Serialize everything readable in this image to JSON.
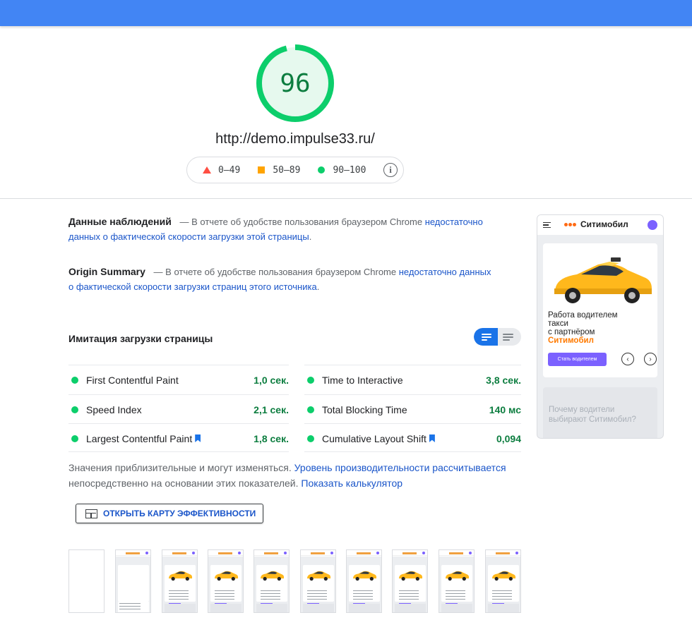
{
  "score": {
    "value": "96",
    "fraction": 0.96,
    "color": "#0cce6b"
  },
  "url": "http://demo.impulse33.ru/",
  "legend": {
    "low": "0–49",
    "mid": "50–89",
    "high": "90–100",
    "info_glyph": "i"
  },
  "field_data": {
    "title": "Данные наблюдений",
    "dash": "—",
    "text": "В отчете об удобстве пользования браузером Chrome",
    "link": "недостаточно данных о фактической скорости загрузки этой страницы",
    "end": "."
  },
  "origin_summary": {
    "title": "Origin Summary",
    "dash": "—",
    "text": "В отчете об удобстве пользования браузером Chrome",
    "link": "недостаточно данных о фактической скорости загрузки страниц этого источника",
    "end": "."
  },
  "lab": {
    "title": "Имитация загрузки страницы",
    "metrics": [
      {
        "name": "First Contentful Paint",
        "value": "1,0 сек."
      },
      {
        "name": "Time to Interactive",
        "value": "3,8 сек."
      },
      {
        "name": "Speed Index",
        "value": "2,1 сек."
      },
      {
        "name": "Total Blocking Time",
        "value": "140 мс"
      },
      {
        "name": "Largest Contentful Paint",
        "value": "1,8 сек."
      },
      {
        "name": "Cumulative Layout Shift",
        "value": "0,094"
      }
    ]
  },
  "note": {
    "text1": "Значения приблизительные и могут изменяться.",
    "link1": "Уровень производительности рассчитывается",
    "text2": "непосредственно на основании этих показателей.",
    "link2": "Показать калькулятор"
  },
  "treemap_button": "ОТКРЫТЬ КАРТУ ЭФФЕКТИВНОСТИ",
  "phone": {
    "brand": "Ситимобил",
    "headline_1": "Работа водителем",
    "headline_2": "такси",
    "headline_3": "с партнёром",
    "headline_brand": "Ситимобил",
    "cta": "Стать водителем",
    "prev": "‹",
    "next": "›",
    "section_title": "Почему водители выбирают Ситимобил?"
  },
  "colors": {
    "topbar": "#4285f4",
    "pass": "#0cce6b",
    "average": "#ffa400",
    "fail": "#ff4e42",
    "link": "#1a55c9",
    "accent": "#7b61ff"
  }
}
